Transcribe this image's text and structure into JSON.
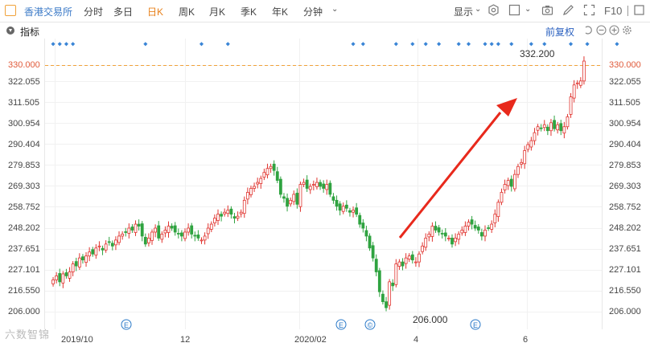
{
  "toolbar": {
    "exchange": "香港交易所",
    "periods": [
      "分时",
      "多日",
      "日K",
      "周K",
      "月K",
      "季K",
      "年K",
      "分钟"
    ],
    "active_period": "日K",
    "display_label": "显示",
    "icons": [
      "settings-icon",
      "checkbox-icon",
      "camera-icon",
      "pencil-icon",
      "fullscreen-icon",
      "f10-icon"
    ],
    "f10_label": "F10"
  },
  "indicator_bar": {
    "label": "指标",
    "adjust_label": "前复权",
    "icons": [
      "undo-icon",
      "zoom-out-icon",
      "zoom-in-icon",
      "settings-gear-icon"
    ]
  },
  "colors": {
    "up": "#e0342f",
    "down": "#2fa340",
    "reference_line": "#f0a23a",
    "arrow": "#e8291c",
    "marker_dot": "#3a85d6",
    "event_marker": "#2a79c8"
  },
  "chart_data": {
    "type": "candlestick",
    "y_ticks": [
      "330.000",
      "322.055",
      "311.505",
      "300.954",
      "290.404",
      "279.853",
      "269.303",
      "258.752",
      "248.202",
      "237.651",
      "227.101",
      "216.550",
      "206.000"
    ],
    "ylim": [
      206.0,
      330.0
    ],
    "reference_value": "330.000",
    "x_tick_labels": [
      "2019/10",
      "12",
      "2020/02",
      "4",
      "6"
    ],
    "annotations": {
      "high": "332.200",
      "low": "206.000"
    },
    "event_markers": [
      "E",
      "E",
      "©",
      "E"
    ],
    "close_series": [
      222,
      224,
      221,
      225,
      224,
      226,
      230,
      229,
      233,
      232,
      234,
      236,
      235,
      238,
      239,
      237,
      240,
      241,
      239,
      242,
      244,
      245,
      246,
      248,
      247,
      250,
      249,
      244,
      240,
      243,
      246,
      248,
      243,
      245,
      247,
      249,
      248,
      246,
      245,
      244,
      246,
      248,
      245,
      244,
      243,
      242,
      244,
      248,
      250,
      253,
      255,
      254,
      256,
      257,
      255,
      253,
      254,
      256,
      262,
      266,
      268,
      269,
      271,
      273,
      276,
      278,
      279,
      277,
      272,
      265,
      263,
      259,
      262,
      265,
      260,
      270,
      271,
      268,
      269,
      270,
      271,
      269,
      268,
      270,
      265,
      262,
      259,
      257,
      259,
      258,
      256,
      257,
      255,
      250,
      248,
      244,
      238,
      233,
      226,
      216,
      211,
      208,
      221,
      219,
      230,
      231,
      229,
      233,
      234,
      232,
      231,
      235,
      239,
      243,
      245,
      249,
      247,
      246,
      245,
      244,
      243,
      240,
      243,
      245,
      247,
      249,
      251,
      250,
      248,
      247,
      244,
      247,
      248,
      250,
      255,
      261,
      266,
      270,
      272,
      269,
      275,
      279,
      281,
      287,
      290,
      292,
      296,
      299,
      298,
      300,
      297,
      301,
      298,
      300,
      297,
      299,
      304,
      314,
      320,
      321,
      322,
      332
    ],
    "marker_dot_indices": [
      0,
      2,
      4,
      6,
      28,
      45,
      53,
      91,
      94,
      104,
      109,
      113,
      117,
      123,
      126,
      131,
      133,
      135,
      139,
      145,
      149,
      157,
      162,
      171
    ],
    "ref_line_start_index": 152
  },
  "watermark": "六数智锦"
}
